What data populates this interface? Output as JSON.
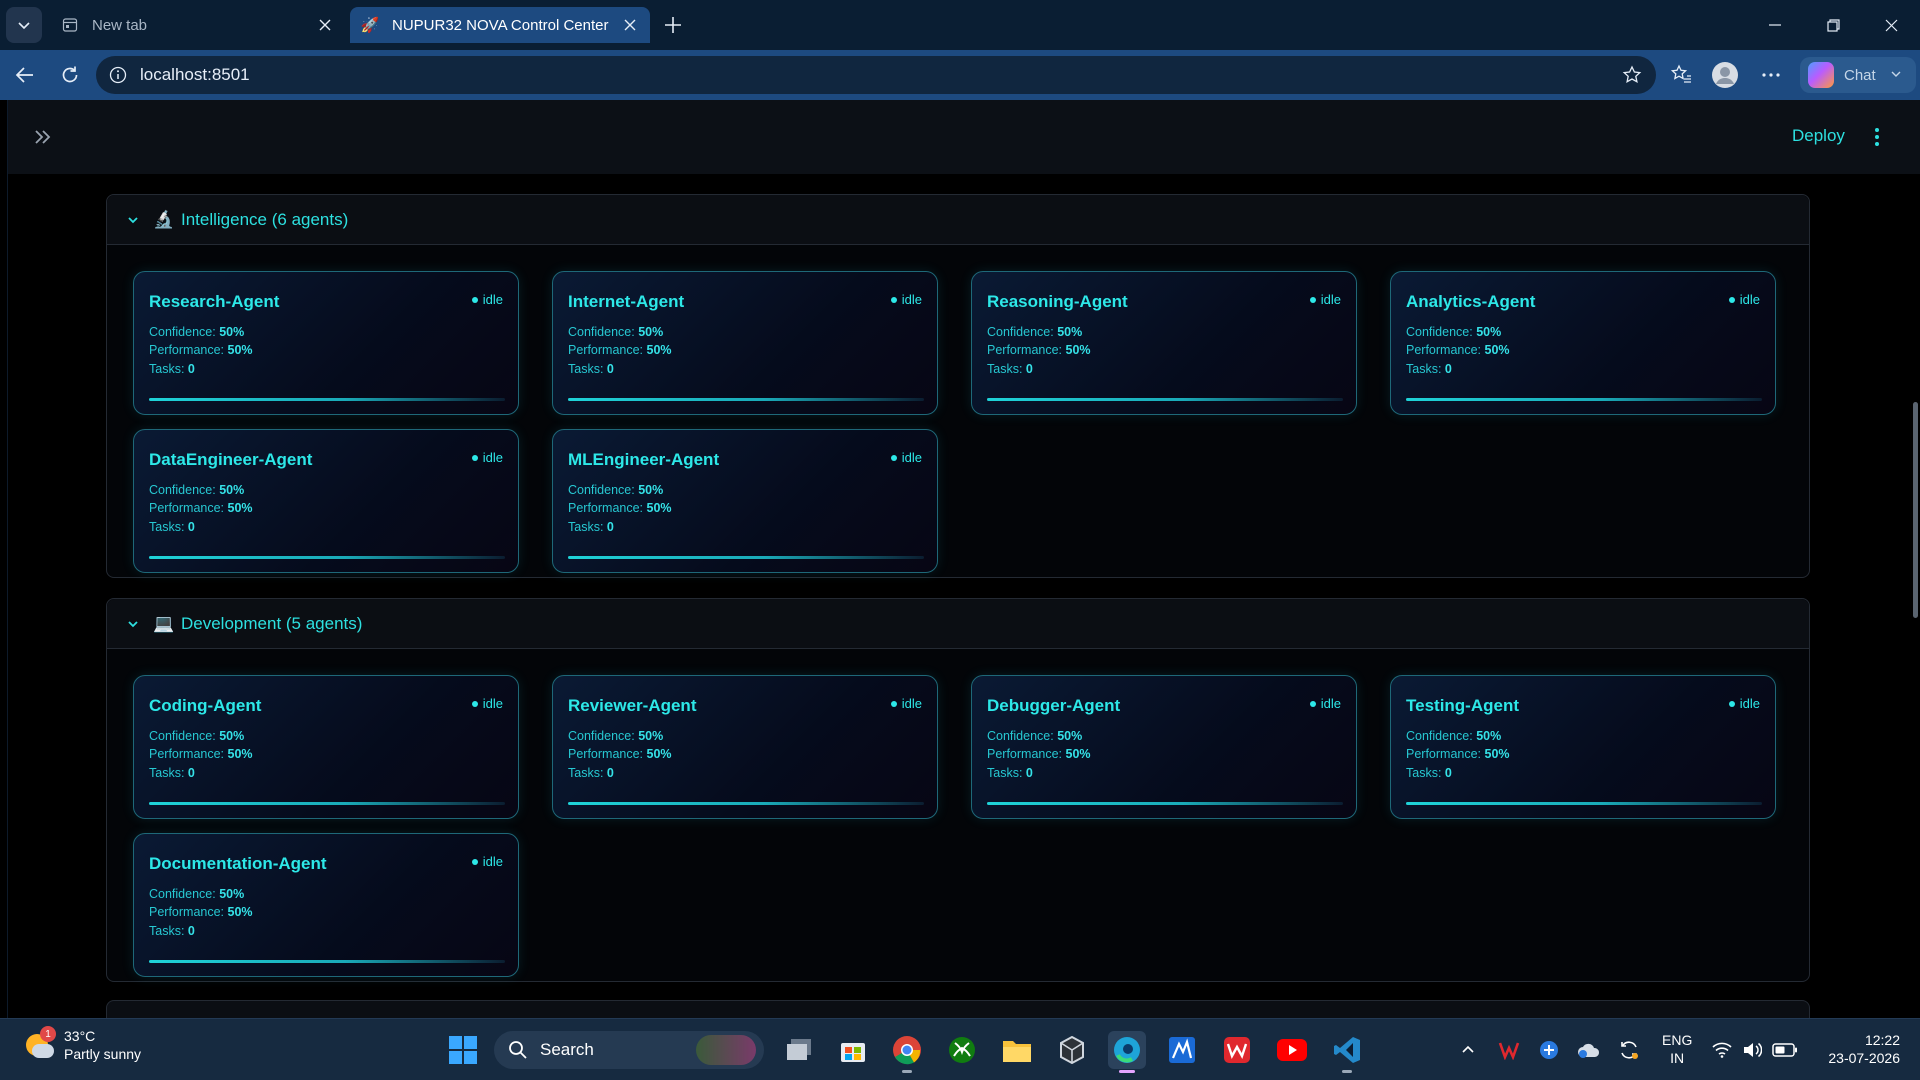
{
  "browser": {
    "tabs": [
      {
        "title": "New tab",
        "icon": "new-tab-page-icon",
        "active": false
      },
      {
        "title": "NUPUR32 NOVA Control Center",
        "icon": "rocket-icon",
        "active": true
      }
    ],
    "url": "localhost:8501",
    "chat_label": "Chat"
  },
  "app": {
    "deploy_label": "Deploy",
    "sections": [
      {
        "emoji": "🔬",
        "title": "Intelligence (6 agents)",
        "agents": [
          {
            "name": "Research-Agent",
            "status": "idle",
            "confidence": "50%",
            "performance": "50%",
            "tasks": "0",
            "progress": 0.5
          },
          {
            "name": "Internet-Agent",
            "status": "idle",
            "confidence": "50%",
            "performance": "50%",
            "tasks": "0",
            "progress": 0.5
          },
          {
            "name": "Reasoning-Agent",
            "status": "idle",
            "confidence": "50%",
            "performance": "50%",
            "tasks": "0",
            "progress": 0.5
          },
          {
            "name": "Analytics-Agent",
            "status": "idle",
            "confidence": "50%",
            "performance": "50%",
            "tasks": "0",
            "progress": 0.5
          },
          {
            "name": "DataEngineer-Agent",
            "status": "idle",
            "confidence": "50%",
            "performance": "50%",
            "tasks": "0",
            "progress": 0.5
          },
          {
            "name": "MLEngineer-Agent",
            "status": "idle",
            "confidence": "50%",
            "performance": "50%",
            "tasks": "0",
            "progress": 0.5
          }
        ]
      },
      {
        "emoji": "💻",
        "title": "Development (5 agents)",
        "agents": [
          {
            "name": "Coding-Agent",
            "status": "idle",
            "confidence": "50%",
            "performance": "50%",
            "tasks": "0",
            "progress": 0.5
          },
          {
            "name": "Reviewer-Agent",
            "status": "idle",
            "confidence": "50%",
            "performance": "50%",
            "tasks": "0",
            "progress": 0.5
          },
          {
            "name": "Debugger-Agent",
            "status": "idle",
            "confidence": "50%",
            "performance": "50%",
            "tasks": "0",
            "progress": 0.5
          },
          {
            "name": "Testing-Agent",
            "status": "idle",
            "confidence": "50%",
            "performance": "50%",
            "tasks": "0",
            "progress": 0.5
          },
          {
            "name": "Documentation-Agent",
            "status": "idle",
            "confidence": "50%",
            "performance": "50%",
            "tasks": "0",
            "progress": 0.5
          }
        ]
      }
    ],
    "labels": {
      "confidence": "Confidence:",
      "performance": "Performance:",
      "tasks": "Tasks:"
    }
  },
  "taskbar": {
    "weather_temp": "33°C",
    "weather_desc": "Partly sunny",
    "weather_badge": "1",
    "search_placeholder": "Search",
    "lang_line1": "ENG",
    "lang_line2": "IN",
    "time": "12:22",
    "date": "23-07-2026"
  },
  "colors": {
    "accent": "#2de0e0",
    "tab_active": "#1d4a80",
    "tabbar": "#0a1e33"
  }
}
